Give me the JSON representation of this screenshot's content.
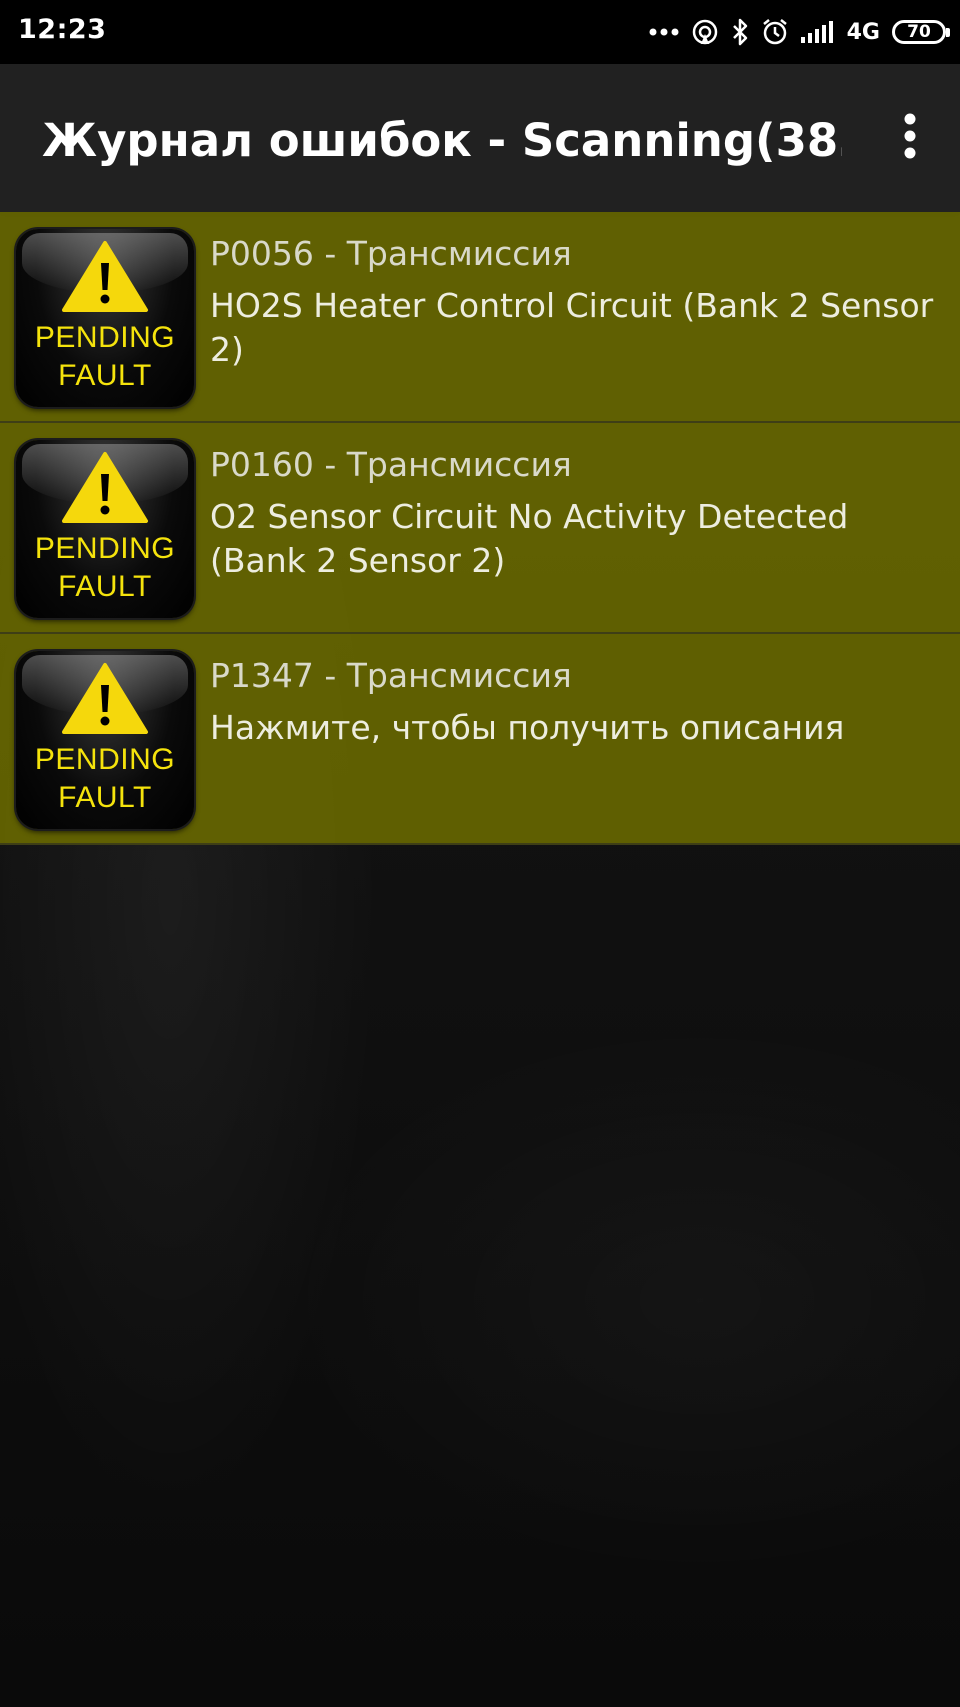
{
  "status_bar": {
    "time": "12:23",
    "network": "4G",
    "battery": "70",
    "icons": [
      "more-dots-icon",
      "hotspot-icon",
      "bluetooth-icon",
      "alarm-icon",
      "signal-icon",
      "network-4g-icon",
      "battery-icon"
    ]
  },
  "app_bar": {
    "title": "Журнал ошибок - Scanning(38…",
    "menu_icon": "more-vert-icon"
  },
  "faults": [
    {
      "code": "P0056 - Трансмиссия",
      "description": "HO2S Heater Control Circuit (Bank 2 Sensor 2)",
      "icon_line1": "PENDING",
      "icon_line2": "FAULT"
    },
    {
      "code": "P0160 - Трансмиссия",
      "description": "O2 Sensor Circuit No Activity Detected (Bank 2 Sensor 2)",
      "icon_line1": "PENDING",
      "icon_line2": "FAULT"
    },
    {
      "code": "P1347 - Трансмиссия",
      "description": "Нажмите, чтобы получить описания",
      "icon_line1": "PENDING",
      "icon_line2": "FAULT"
    }
  ],
  "colors": {
    "list_item_bg": "#686800",
    "icon_text": "#f5e30c",
    "warning_triangle": "#f5d80c",
    "app_bar": "#212121"
  }
}
